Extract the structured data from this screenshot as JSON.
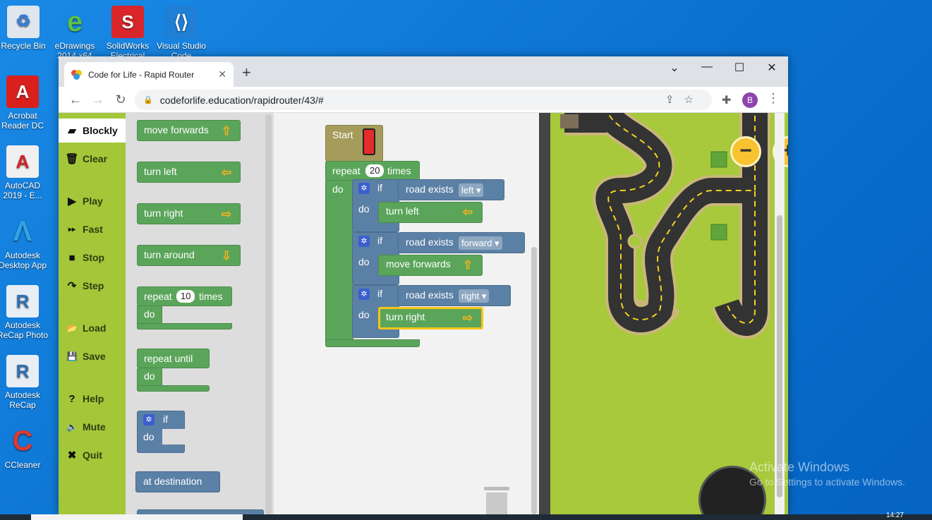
{
  "desktop": {
    "icons": [
      {
        "label": "Recycle Bin",
        "color": "#dfe6ee",
        "glyph": "🗑"
      },
      {
        "label": "eDrawings 2014 x64",
        "color": "#2f9c3c",
        "glyph": "e"
      },
      {
        "label": "SolidWorks Electrical",
        "color": "#d9262b",
        "glyph": "S"
      },
      {
        "label": "Visual Studio Code",
        "color": "#1f7fd4",
        "glyph": "≺"
      },
      {
        "label": "Acrobat Reader DC",
        "color": "#d9201c",
        "glyph": "A"
      },
      {
        "label": "AutoCAD 2019 - E...",
        "color": "#d32128",
        "glyph": "A"
      },
      {
        "label": "Autodesk Desktop App",
        "color": "#1b79c6",
        "glyph": "A"
      },
      {
        "label": "Autodesk ReCap Photo",
        "color": "#2d6fb4",
        "glyph": "R"
      },
      {
        "label": "Autodesk ReCap",
        "color": "#2d6fb4",
        "glyph": "R"
      },
      {
        "label": "CCleaner",
        "color": "#c8302d",
        "glyph": "C"
      }
    ],
    "watermark_title": "Activate Windows",
    "watermark_sub": "Go to Settings to activate Windows.",
    "clock": "14:27"
  },
  "browser": {
    "tab_title": "Code for Life - Rapid Router",
    "tab_close": "✕",
    "new_tab": "+",
    "url": "codeforlife.education/rapidrouter/43/#",
    "profile_initial": "B",
    "min": "—",
    "max": "☐",
    "close": "✕",
    "collapse": "⌄"
  },
  "sidebar": {
    "items": [
      {
        "label": "Blockly",
        "icon": "▰"
      },
      {
        "label": "Clear",
        "icon": "🗑"
      },
      {
        "label": "Play",
        "icon": "▶"
      },
      {
        "label": "Fast",
        "icon": "▸▸"
      },
      {
        "label": "Stop",
        "icon": "■"
      },
      {
        "label": "Step",
        "icon": "↷"
      },
      {
        "label": "Load",
        "icon": "📂"
      },
      {
        "label": "Save",
        "icon": "💾"
      },
      {
        "label": "Help",
        "icon": "?"
      },
      {
        "label": "Mute",
        "icon": "🔈"
      },
      {
        "label": "Quit",
        "icon": "✖"
      }
    ]
  },
  "toolbox": {
    "move_forwards": "move forwards",
    "turn_left": "turn left",
    "turn_right": "turn right",
    "turn_around": "turn around",
    "repeat": "repeat",
    "repeat_count": "10",
    "times": "times",
    "do": "do",
    "repeat_until": "repeat until",
    "if": "if",
    "at_destination": "at destination"
  },
  "program": {
    "start": "Start",
    "repeat": "repeat",
    "repeat_count": "20",
    "times": "times",
    "do": "do",
    "if": "if",
    "road_exists": "road exists",
    "dir1": "left",
    "dir2": "forward",
    "dir3": "right",
    "action1": "turn left",
    "action2": "move forwards",
    "action3": "turn right"
  },
  "colors": {
    "sidebar": "#a4c639",
    "action_block": "#5ba55b",
    "logic_block": "#5b80a5",
    "start_block": "#a59c5b",
    "selected_outline": "#f5c518"
  }
}
